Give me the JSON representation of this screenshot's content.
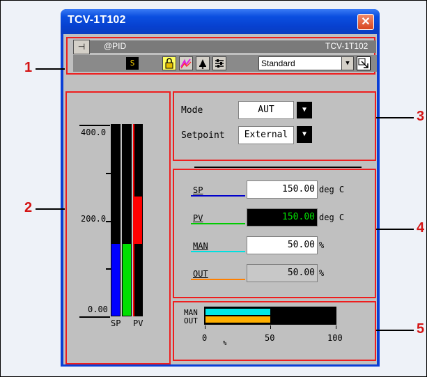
{
  "window": {
    "title": "TCV-1T102",
    "close_glyph": "✕"
  },
  "toolbar": {
    "block_type": "@PID",
    "tag_name": "TCV-1T102",
    "status_indicator": "S",
    "display_mode": "Standard"
  },
  "bargraph": {
    "scale_high": "400.0",
    "scale_mid": "200.0",
    "scale_low": "0.00",
    "sp_label": "SP",
    "pv_label": "PV",
    "range": [
      0,
      400
    ],
    "sp_value": 150,
    "man_value": 150,
    "pv_value": 250,
    "pv_value_low": 150,
    "colors": {
      "sp": "#0000ff",
      "man": "#00e000",
      "pv": "#ff0000"
    }
  },
  "mode_panel": {
    "mode_label": "Mode",
    "mode_value": "AUT",
    "setpoint_label": "Setpoint",
    "setpoint_value": "External"
  },
  "values": [
    {
      "label": "SP",
      "value": "150.00",
      "unit": "deg C",
      "color": "#0000cc"
    },
    {
      "label": "PV",
      "value": "150.00",
      "unit": "deg C",
      "color": "#00cc00"
    },
    {
      "label": "MAN",
      "value": "50.00",
      "unit": "%",
      "color": "#00e0e0"
    },
    {
      "label": "OUT",
      "value": "50.00",
      "unit": "%",
      "color": "#ff8000"
    }
  ],
  "output_bar": {
    "man_label": "MAN",
    "out_label": "OUT",
    "tick_0": "0",
    "tick_50": "50",
    "tick_100": "100",
    "unit": "%",
    "man_percent": 50,
    "out_percent": 50,
    "colors": {
      "man": "#00e8e8",
      "out": "#ffb000"
    }
  },
  "callouts": [
    "1",
    "2",
    "3",
    "4",
    "5"
  ]
}
